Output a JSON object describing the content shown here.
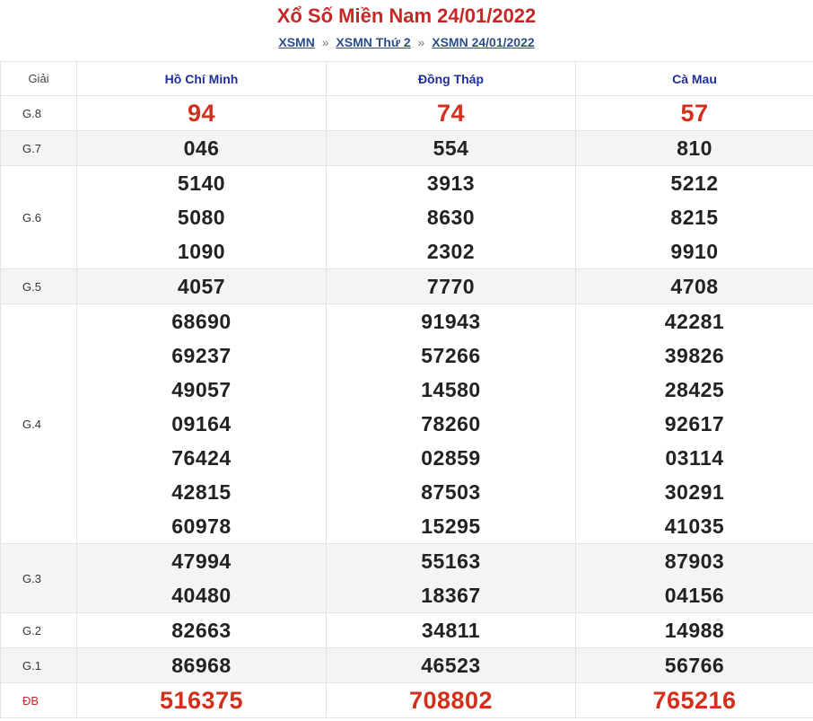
{
  "page": {
    "title": "Xổ Số Miền Nam 24/01/2022",
    "breadcrumb": [
      "XSMN",
      "XSMN Thứ 2",
      "XSMN 24/01/2022"
    ],
    "breadcrumb_separator": "»"
  },
  "colors": {
    "title": "#c62828",
    "province_header": "#1e2e9e",
    "highlight_number": "#d32f1d",
    "link": "#2a4d8a"
  },
  "table": {
    "label_header": "Giải",
    "provinces": [
      "Hồ Chí Minh",
      "Đồng Tháp",
      "Cà Mau"
    ],
    "rows": [
      {
        "prize": "G.8",
        "values": [
          [
            "94"
          ],
          [
            "74"
          ],
          [
            "57"
          ]
        ]
      },
      {
        "prize": "G.7",
        "values": [
          [
            "046"
          ],
          [
            "554"
          ],
          [
            "810"
          ]
        ]
      },
      {
        "prize": "G.6",
        "values": [
          [
            "5140",
            "5080",
            "1090"
          ],
          [
            "3913",
            "8630",
            "2302"
          ],
          [
            "5212",
            "8215",
            "9910"
          ]
        ]
      },
      {
        "prize": "G.5",
        "values": [
          [
            "4057"
          ],
          [
            "7770"
          ],
          [
            "4708"
          ]
        ]
      },
      {
        "prize": "G.4",
        "values": [
          [
            "68690",
            "69237",
            "49057",
            "09164",
            "76424",
            "42815",
            "60978"
          ],
          [
            "91943",
            "57266",
            "14580",
            "78260",
            "02859",
            "87503",
            "15295"
          ],
          [
            "42281",
            "39826",
            "28425",
            "92617",
            "03114",
            "30291",
            "41035"
          ]
        ]
      },
      {
        "prize": "G.3",
        "values": [
          [
            "47994",
            "40480"
          ],
          [
            "55163",
            "18367"
          ],
          [
            "87903",
            "04156"
          ]
        ]
      },
      {
        "prize": "G.2",
        "values": [
          [
            "82663"
          ],
          [
            "34811"
          ],
          [
            "14988"
          ]
        ]
      },
      {
        "prize": "G.1",
        "values": [
          [
            "86968"
          ],
          [
            "46523"
          ],
          [
            "56766"
          ]
        ]
      },
      {
        "prize": "ĐB",
        "values": [
          [
            "516375"
          ],
          [
            "708802"
          ],
          [
            "765216"
          ]
        ]
      }
    ]
  }
}
